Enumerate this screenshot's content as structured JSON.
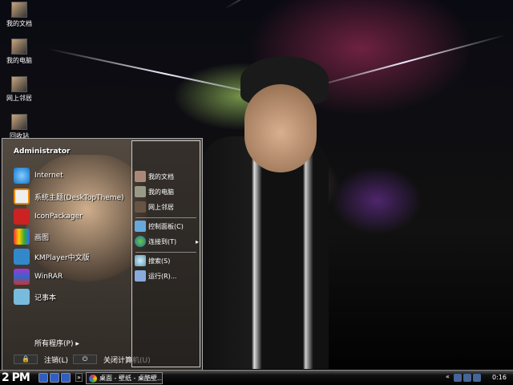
{
  "desktop": {
    "icons": [
      {
        "label": "我的文档"
      },
      {
        "label": "我的电脑"
      },
      {
        "label": "网上邻居"
      },
      {
        "label": "回收站"
      }
    ]
  },
  "start_menu": {
    "user": "Administrator",
    "programs": [
      {
        "label": "Internet",
        "icon": "ie-icon"
      },
      {
        "label": "系统主题(DeskTopTheme)",
        "icon": "theme-icon"
      },
      {
        "label": "IconPackager",
        "icon": "iconpackager-icon"
      },
      {
        "label": "画图",
        "icon": "paint-icon"
      },
      {
        "label": "KMPlayer中文版",
        "icon": "kmplayer-icon"
      },
      {
        "label": "WinRAR",
        "icon": "winrar-icon"
      },
      {
        "label": "记事本",
        "icon": "notepad-icon"
      }
    ],
    "all_programs": "所有程序(P)",
    "right": [
      {
        "label": "我的文档"
      },
      {
        "label": "我的电脑"
      },
      {
        "label": "网上邻居"
      },
      {
        "label": "控制面板(C)"
      },
      {
        "label": "连接到(T)",
        "arrow": "▸"
      },
      {
        "label": "搜索(S)"
      },
      {
        "label": "运行(R)..."
      }
    ],
    "logoff": "注销(L)",
    "shutdown": "关闭计算机(U)"
  },
  "taskbar": {
    "start_label": "2 PM",
    "overflow": "»",
    "task": "桌面 - 壁纸 - 桌酷壁...",
    "clock": "0:16",
    "tray_arrow": "«"
  }
}
